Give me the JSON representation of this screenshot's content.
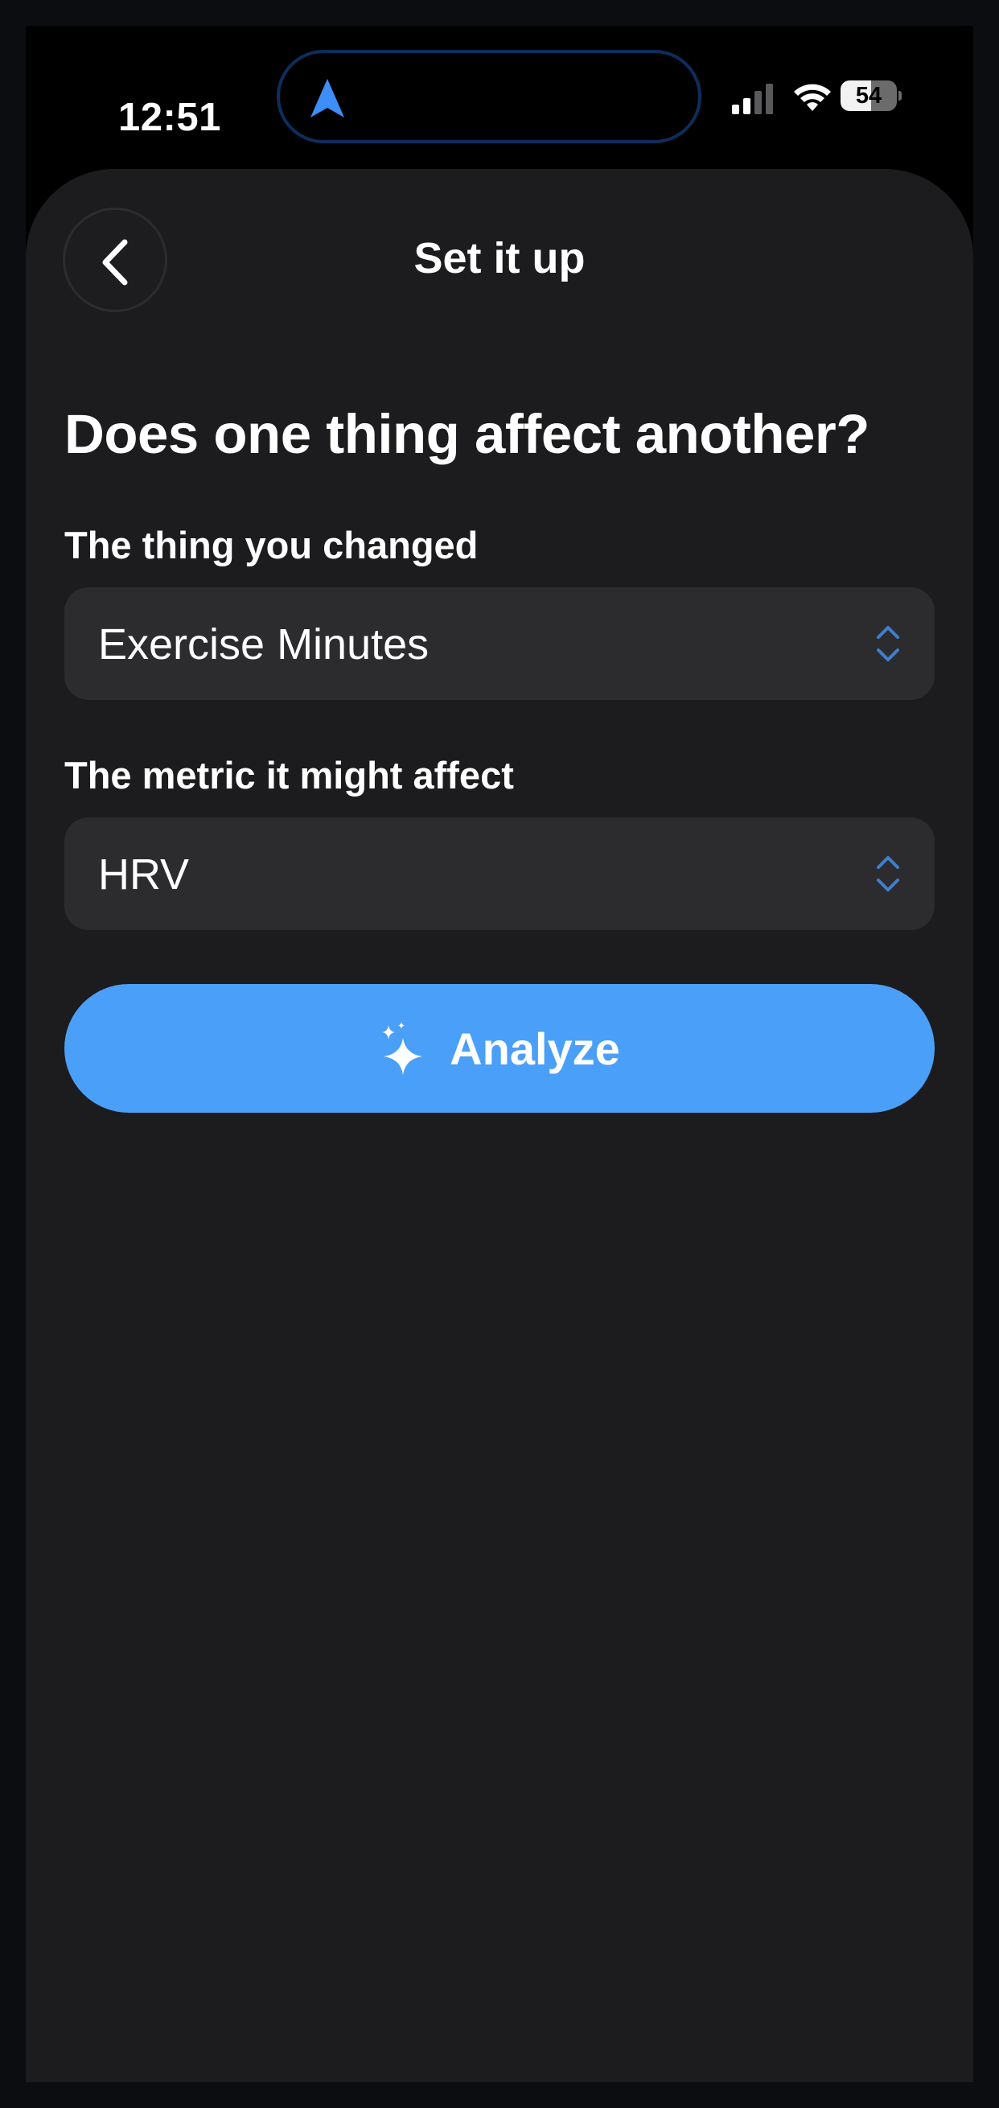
{
  "status_bar": {
    "time": "12:51",
    "battery": "54",
    "location_icon": "location-arrow-icon",
    "signal_icon": "cellular-signal-icon",
    "wifi_icon": "wifi-icon"
  },
  "header": {
    "title": "Set it up",
    "back_icon": "chevron-left-icon"
  },
  "main": {
    "question": "Does one thing affect another?",
    "fields": [
      {
        "label": "The thing you changed",
        "value": "Exercise Minutes",
        "icon": "chevron-up-down-icon"
      },
      {
        "label": "The metric it might affect",
        "value": "HRV",
        "icon": "chevron-up-down-icon"
      }
    ],
    "analyze_button": {
      "label": "Analyze",
      "icon": "sparkles-icon"
    }
  },
  "colors": {
    "accent": "#4a9ff9",
    "sheet_background": "#1c1c1e",
    "field_background": "#2c2c2e",
    "chevron": "#3f7fd0"
  }
}
